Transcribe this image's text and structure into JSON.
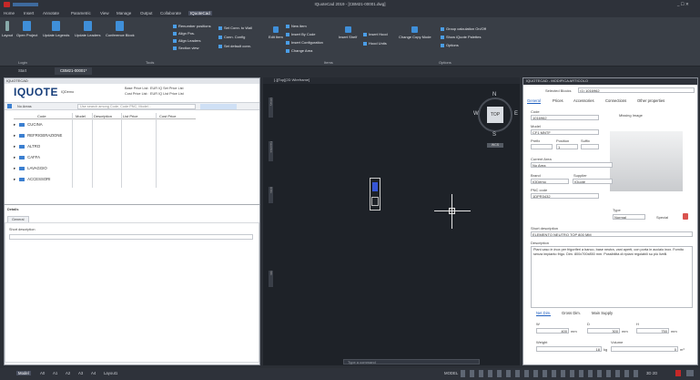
{
  "app": {
    "title": "IQuoteCad 2019 - [CBM21-00001.dwg]",
    "window_controls": "_ ☐ ✕"
  },
  "ribbon": {
    "tabs": [
      "Home",
      "Insert",
      "Annotate",
      "Parametric",
      "View",
      "Manage",
      "Output",
      "Collaborate",
      "IQuoteCad"
    ],
    "active_tab": "IQuoteCad",
    "large_buttons": [
      "Layout",
      "Open Project",
      "Update Legends",
      "Update Leaders",
      "Conference Block"
    ],
    "small_buttons_col1": [
      "Renumber positions",
      "Align Pos.",
      "Align Leaders",
      "Section view"
    ],
    "small_buttons_col2": [
      "Set Conn. to Wall",
      "Conn. Config",
      "Set default conn."
    ],
    "edit_item_label": "Edit Item",
    "small_buttons_col3": [
      "New item",
      "Insert By Code",
      "Insert Configuration",
      "Change Area"
    ],
    "insert_shelf_label": "Insert Shelf",
    "small_buttons_col4": [
      "Insert Hood",
      "Hood Units"
    ],
    "change_copy_mode_label": "Change Copy Mode",
    "options_items": [
      "Group calculation On/Off",
      "Show iQuote Palettes",
      "Options"
    ],
    "group_labels": [
      "Login",
      "Tools",
      "Items",
      "Options"
    ]
  },
  "doc_tabs": [
    "Start",
    "CBM21-00001*"
  ],
  "left_panel": {
    "header": "IQUOTECAD",
    "brand": "IQUOTE",
    "supplier_label": "IQDemo",
    "price_list_label": "Base Price List:",
    "price_list_value": "EUR IQ Set Price List",
    "cost_price_label": "Cost Price List:",
    "cost_price_value": "EUR IQ List Price List",
    "filter_label": "No Areas",
    "search_placeholder": "Use search among Code, Code PNC, Model...",
    "columns": [
      "Code",
      "Model",
      "Description",
      "List Price",
      "Cost Price"
    ],
    "rows": [
      "CUCINA",
      "REFRIGERAZIONE",
      "ALTRO",
      "CAFFA",
      "LAVAGGIO",
      "ACCESSORI"
    ],
    "details_header": "Details",
    "details_tab": "General",
    "short_description_label": "Short description"
  },
  "viewport": {
    "header": "[-][Top][2D Wireframe]",
    "viewcube_top": "TOP",
    "compass": [
      "N",
      "S",
      "W",
      "E"
    ],
    "wcs": "WCS",
    "command_placeholder": "Type a command",
    "side_tabs": [
      "Library",
      "Favorites",
      "Hints",
      "Info"
    ]
  },
  "right_panel": {
    "header": "IQUOTECAD - MODIFICA ARTICOLO",
    "selected_blocks_label": "Selected Blocks",
    "selected_blocks_value": "(1) 1016962",
    "tabs": [
      "General",
      "Prices",
      "Accessories",
      "Connections",
      "Other properties"
    ],
    "code_label": "Code",
    "code_value": "1016962",
    "missing_image_label": "Missing Image",
    "model_label": "Model",
    "model_value": "CF1 MNTF",
    "prefix_label": "Prefix",
    "position_label": "Position",
    "suffix_label": "Suffix",
    "position_value": "1",
    "current_area_label": "Current Area",
    "current_area_value": "No Area",
    "brand_label": "Brand",
    "supplier_label": "Supplier",
    "brand_value": "IQDemo",
    "supplier_value": "IQuote",
    "pnc_label": "PNC code",
    "pnc_value": "1DPR3432",
    "type_label": "Type",
    "type_value": "Normal",
    "special_label": "Special",
    "short_desc_label": "Short description",
    "short_desc_value": "ELEMENTO NEUTRO TOP 800 MM",
    "description_label": "Description",
    "description_value": "Piani caso in inox per frigoriferi a banco, base neutra, vani aperti, con porta in acciaio inox. Fornito senza impianto frigo. Dim. 800x700x850 mm. Possibilità di ripiani regolabili su più livelli.",
    "bottom_tabs": [
      "Net Dim.",
      "Gross Dim.",
      "Main Supply"
    ],
    "w_label": "W",
    "d_label": "D",
    "h_label": "H",
    "w_value": "400",
    "d_value": "300",
    "h_value": "750",
    "unit_mm": "mm",
    "weight_label": "Weight",
    "volume_label": "Volume",
    "weight_value": "18",
    "weight_unit": "kg",
    "volume_value": "0",
    "volume_unit": "m³"
  },
  "status": {
    "layout_tabs": [
      "Model",
      "A0",
      "A1",
      "A2",
      "A3",
      "A4",
      "Layout1"
    ],
    "active_layout": "Model",
    "model_label": "MODEL",
    "right_text": "3D 2D"
  },
  "colors": {
    "accent": "#3b7fd0",
    "brand": "#173e7a",
    "ribbon_bg": "#393e46",
    "viewport_bg": "#1e2228"
  }
}
